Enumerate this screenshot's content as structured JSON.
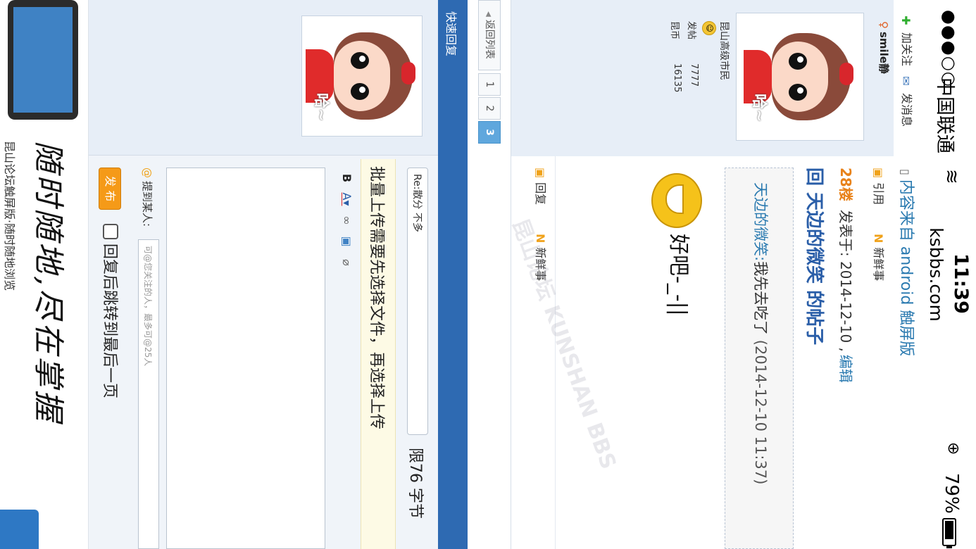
{
  "status_bar": {
    "signal": "●●●○○",
    "carrier": "中国联通",
    "time": "11:39",
    "url": "ksbbs.com",
    "battery_percent": "79%"
  },
  "post": {
    "toolbar": {
      "follow": "加关注",
      "message": "发消息"
    },
    "source": "内容来自 android 触屏版",
    "author": {
      "name": "smile静",
      "rank": "昆山高级市民",
      "posts_label": "发帖",
      "posts_value": "7777",
      "coins_label": "昆币",
      "coins_value": "16135"
    },
    "floor": "28楼",
    "posted_at": "发表于: 2014-12-10 ,",
    "edit_label": "编辑",
    "title": "回 天边的微笑 的帖子",
    "quote": {
      "author": "天边的微笑:",
      "text": "我先去吃了",
      "time": "(2014-12-10 11:37)"
    },
    "body": "好吧-_-||",
    "actions": {
      "quote": "引用",
      "reply": "回复",
      "news1": "新鲜事",
      "news2": "新鲜事"
    }
  },
  "pagination": {
    "back": "返回列表",
    "pages": [
      "1",
      "2",
      "3"
    ],
    "current": "3"
  },
  "quick_reply": {
    "title": "快速回复",
    "subject_value": "Re:散分 不多",
    "char_limit": "限76 字节",
    "notice": "批量上传需要先选择文件，再选择上传",
    "mention_label": "提到某人:",
    "mention_placeholder": "可@您关注的人，最多可@25人",
    "publish": "发 布",
    "jump_label": "回复后跳转到最后一页"
  },
  "promo": {
    "slogan": "随时随地,尽在掌握",
    "subtitle": "昆山论坛触屏版·随时随地浏览"
  },
  "watermark": "昆山论坛 KUNSHAN BBS"
}
